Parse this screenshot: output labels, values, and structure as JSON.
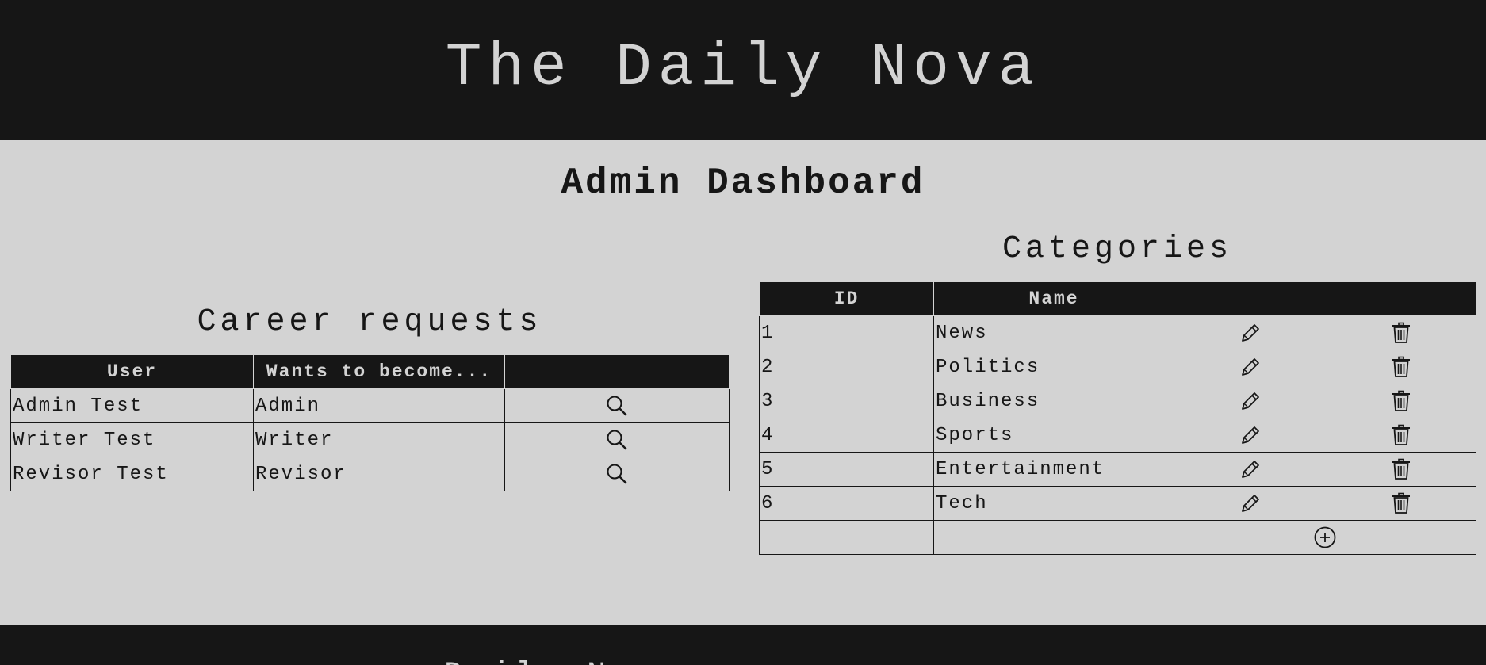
{
  "header": {
    "site_title": "The Daily Nova"
  },
  "main": {
    "page_title": "Admin Dashboard"
  },
  "career_requests": {
    "title": "Career requests",
    "columns": [
      "User",
      "Wants to become...",
      ""
    ],
    "rows": [
      {
        "user": "Admin Test",
        "role": "Admin",
        "action_icon": "search-icon"
      },
      {
        "user": "Writer Test",
        "role": "Writer",
        "action_icon": "search-icon"
      },
      {
        "user": "Revisor Test",
        "role": "Revisor",
        "action_icon": "search-icon"
      }
    ]
  },
  "categories": {
    "title": "Categories",
    "columns": [
      "ID",
      "Name",
      ""
    ],
    "rows": [
      {
        "id": "1",
        "name": "News"
      },
      {
        "id": "2",
        "name": "Politics"
      },
      {
        "id": "3",
        "name": "Business"
      },
      {
        "id": "4",
        "name": "Sports"
      },
      {
        "id": "5",
        "name": "Entertainment"
      },
      {
        "id": "6",
        "name": "Tech"
      }
    ],
    "row_actions": [
      "pencil-icon",
      "trash-icon"
    ],
    "add_action": "plus-circle-icon"
  },
  "footer": {
    "partial_text": "Daily N"
  },
  "colors": {
    "dark": "#161616",
    "light": "#d3d3d3"
  }
}
